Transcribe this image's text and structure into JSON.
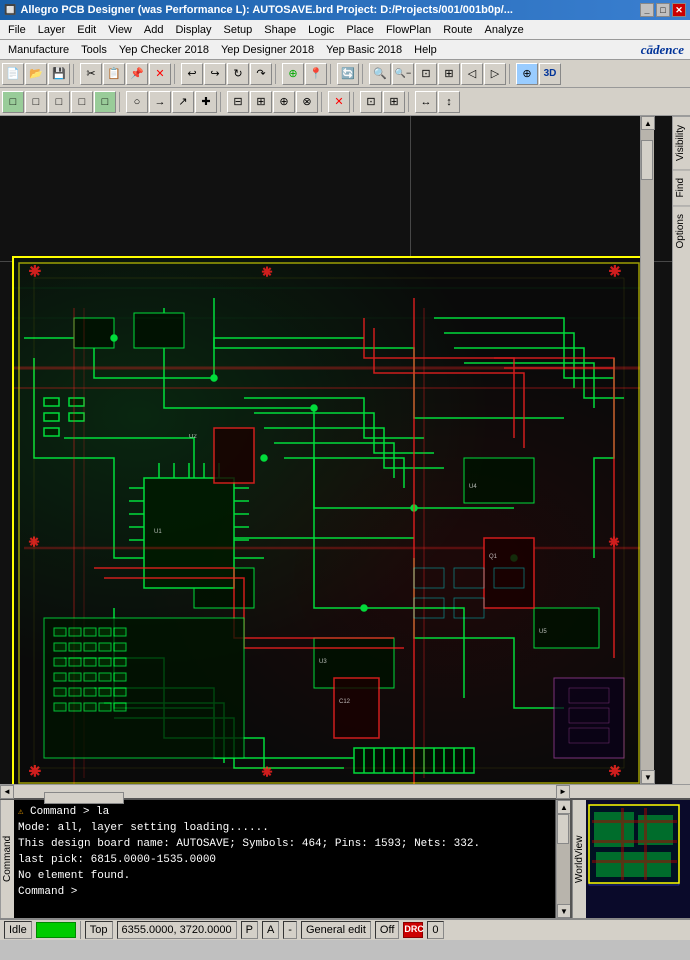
{
  "title_bar": {
    "icon": "🔲",
    "title": "Allegro PCB Designer (was Performance L): AUTOSAVE.brd  Project: D:/Projects/001/001b0p/...",
    "minimize": "_",
    "maximize": "□",
    "close": "✕"
  },
  "menu_bar1": {
    "items": [
      "File",
      "Layer",
      "Edit",
      "View",
      "Add",
      "Display",
      "Setup",
      "Shape",
      "Logic",
      "Place",
      "FlowPlan",
      "Route",
      "Analyze"
    ]
  },
  "menu_bar2": {
    "items": [
      "Manufacture",
      "Tools",
      "Yep Checker 2018",
      "Yep Designer 2018",
      "Yep Basic 2018",
      "Help"
    ],
    "logo": "cādence"
  },
  "status_bar": {
    "idle": "Idle",
    "layer": "Top",
    "coords": "6355.0000, 3720.0000",
    "p_indicator": "P",
    "a_indicator": "A",
    "dash": "-",
    "mode": "General edit",
    "off": "Off",
    "drc": "DRC",
    "num": "0"
  },
  "command_log": {
    "lines": [
      "Command > la",
      "Mode: all, layer setting loading......",
      "This design board name: AUTOSAVE; Symbols: 464; Pins: 1593; Nets: 332.",
      "last pick:  6815.0000-1535.0000",
      "No element found.",
      "Command >"
    ]
  },
  "side_tabs": {
    "visibility": "Visibility",
    "find": "Find",
    "options": "Options"
  },
  "worldview_label": "WorldView",
  "toolbar1_icons": [
    "📂",
    "💾",
    "🖨",
    "✂",
    "📋",
    "↩",
    "↪",
    "🔍",
    "📌",
    "🔄",
    "⊕",
    "⊗",
    "🔎",
    "🔍",
    "🔲",
    "⬛"
  ],
  "toolbar2_icons": [
    "□",
    "□",
    "□",
    "□",
    "□",
    "□",
    "□",
    "□",
    "□",
    "□",
    "□",
    "□",
    "□",
    "□",
    "□",
    "□",
    "□",
    "□",
    "□",
    "□"
  ],
  "pcb": {
    "background": "#0a0a0a",
    "board_color": "#ffff00",
    "trace_green": "#00ff44",
    "trace_red": "#ff2222"
  }
}
